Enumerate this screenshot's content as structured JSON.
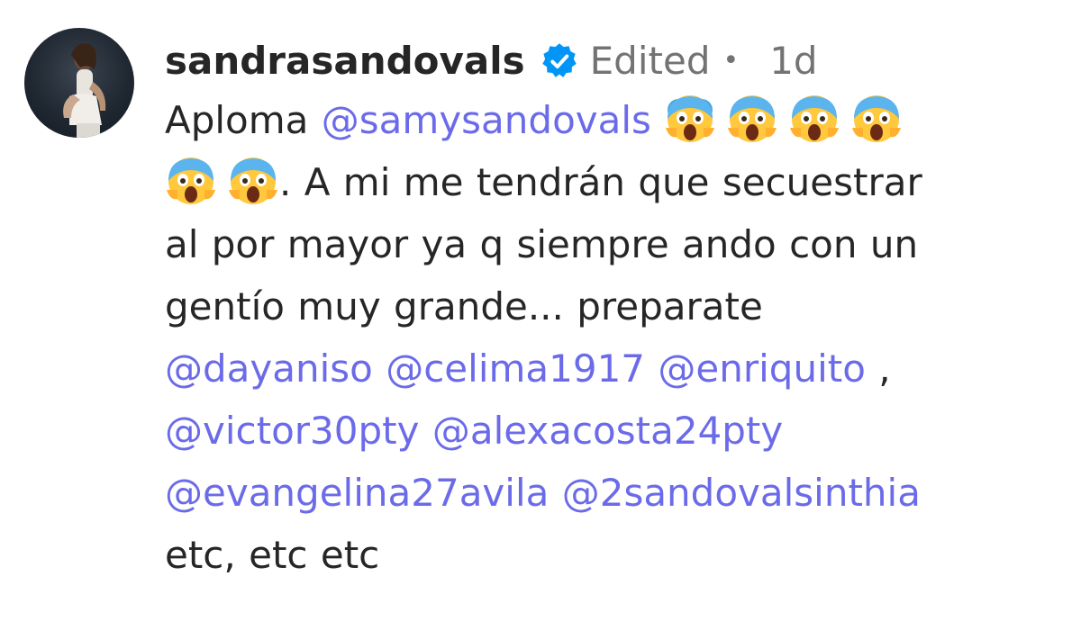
{
  "comment": {
    "username": "sandrasandovals",
    "edited_label": "Edited",
    "separator": "•",
    "time_ago": "1d",
    "verified_icon": "verified-badge-icon",
    "emoji_icon": "face-screaming-in-fear",
    "text": {
      "line1_prefix": "Aploma",
      "mention_1": "@samysandovals",
      "line2_suffix": ". A mi me tendrán que secuestrar",
      "line3": "al por mayor ya q siempre ando con un",
      "line4": "gentío muy grande... preparate",
      "mentions_line5": [
        "@dayaniso",
        "@celima1917",
        "@enriquito"
      ],
      "comma_after_enriquito": ",",
      "mentions_line6": [
        "@victor30pty",
        "@alexacosta24pty"
      ],
      "mentions_line7": [
        "@evangelina27avila",
        "@2sandovalsinthia"
      ],
      "line8": "etc, etc etc"
    }
  },
  "colors": {
    "text": "#262626",
    "meta": "#737373",
    "mention": "#6b6bea",
    "verified": "#0095f6"
  }
}
